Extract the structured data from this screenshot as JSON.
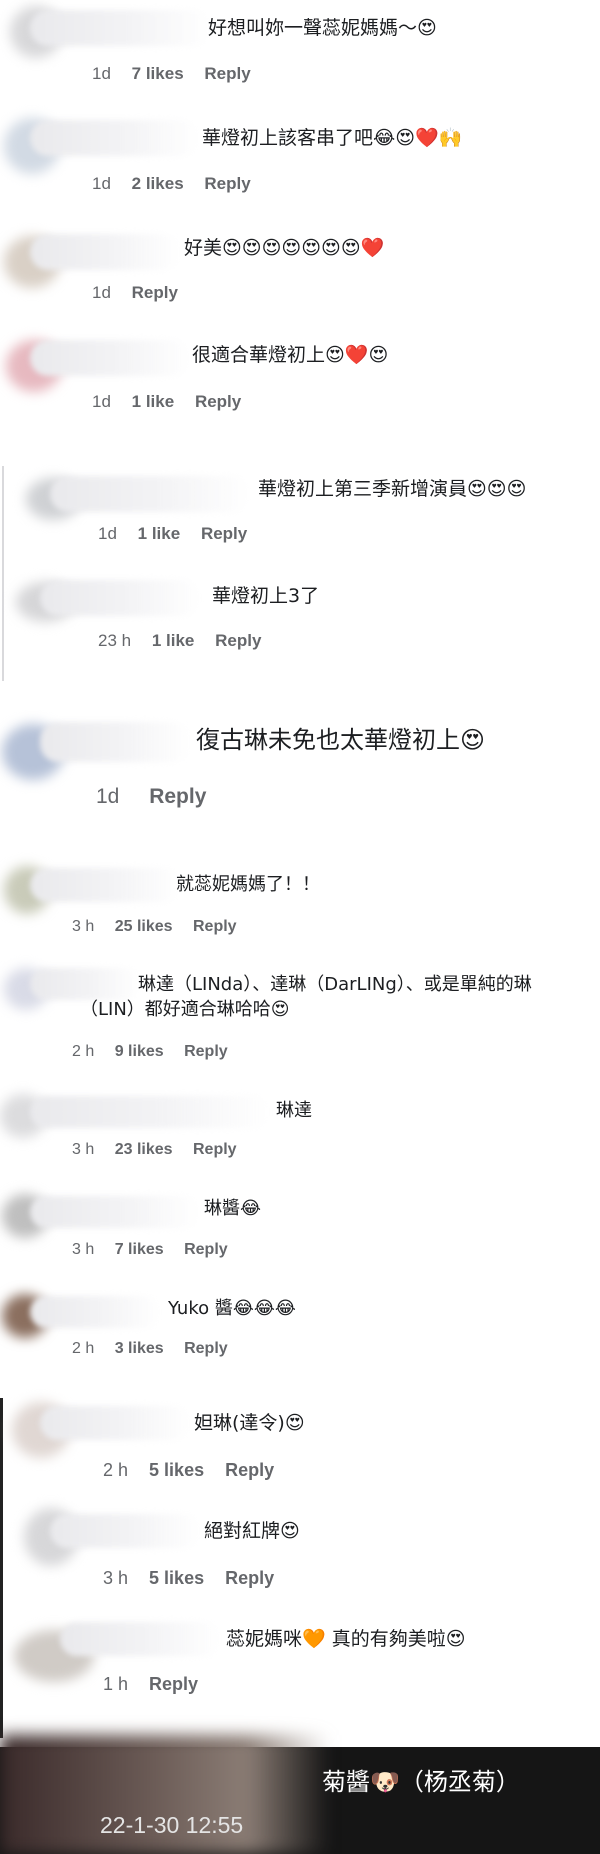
{
  "comments": [
    {
      "text": "好想叫妳一聲蕊妮媽媽～😍",
      "time": "1d",
      "likes": "7 likes",
      "reply": "Reply"
    },
    {
      "text": "華燈初上該客串了吧😂😍❤️🙌",
      "time": "1d",
      "likes": "2 likes",
      "reply": "Reply"
    },
    {
      "text": "好美😍😍😍😍😍😍😍❤️",
      "time": "1d",
      "likes": "",
      "reply": "Reply"
    },
    {
      "text": "很適合華燈初上😍❤️😍",
      "time": "1d",
      "likes": "1 like",
      "reply": "Reply"
    },
    {
      "text": "華燈初上第三季新增演員😍😍😍",
      "time": "1d",
      "likes": "1 like",
      "reply": "Reply"
    },
    {
      "text": "華燈初上3了",
      "time": "23 h",
      "likes": "1 like",
      "reply": "Reply"
    },
    {
      "text": "復古琳未免也太華燈初上😍",
      "time": "1d",
      "likes": "",
      "reply": "Reply"
    },
    {
      "text": "就蕊妮媽媽了！！",
      "time": "3 h",
      "likes": "25 likes",
      "reply": "Reply"
    },
    {
      "text": "琳達（LINda）、達琳（DarLINg）、或是單純的琳",
      "text2": "（LIN）都好適合琳哈哈😍",
      "time": "2 h",
      "likes": "9 likes",
      "reply": "Reply"
    },
    {
      "text": "琳達",
      "time": "3 h",
      "likes": "23 likes",
      "reply": "Reply"
    },
    {
      "text": "琳醬😂",
      "time": "3 h",
      "likes": "7 likes",
      "reply": "Reply"
    },
    {
      "text": "Yuko 醬😂😂😂",
      "time": "2 h",
      "likes": "3 likes",
      "reply": "Reply"
    },
    {
      "text": "妲琳(達令)😍",
      "time": "2 h",
      "likes": "5 likes",
      "reply": "Reply"
    },
    {
      "text": "絕對紅牌😍",
      "time": "3 h",
      "likes": "5 likes",
      "reply": "Reply"
    },
    {
      "text": "蕊妮媽咪🧡 真的有夠美啦😍",
      "time": "1 h",
      "likes": "",
      "reply": "Reply"
    }
  ],
  "footer": {
    "name": "菊醬🐶（杨丞菊）",
    "date": "22-1-30 12:55"
  },
  "colors": {
    "meta": "#65676b",
    "dark_bar": "#151515"
  }
}
